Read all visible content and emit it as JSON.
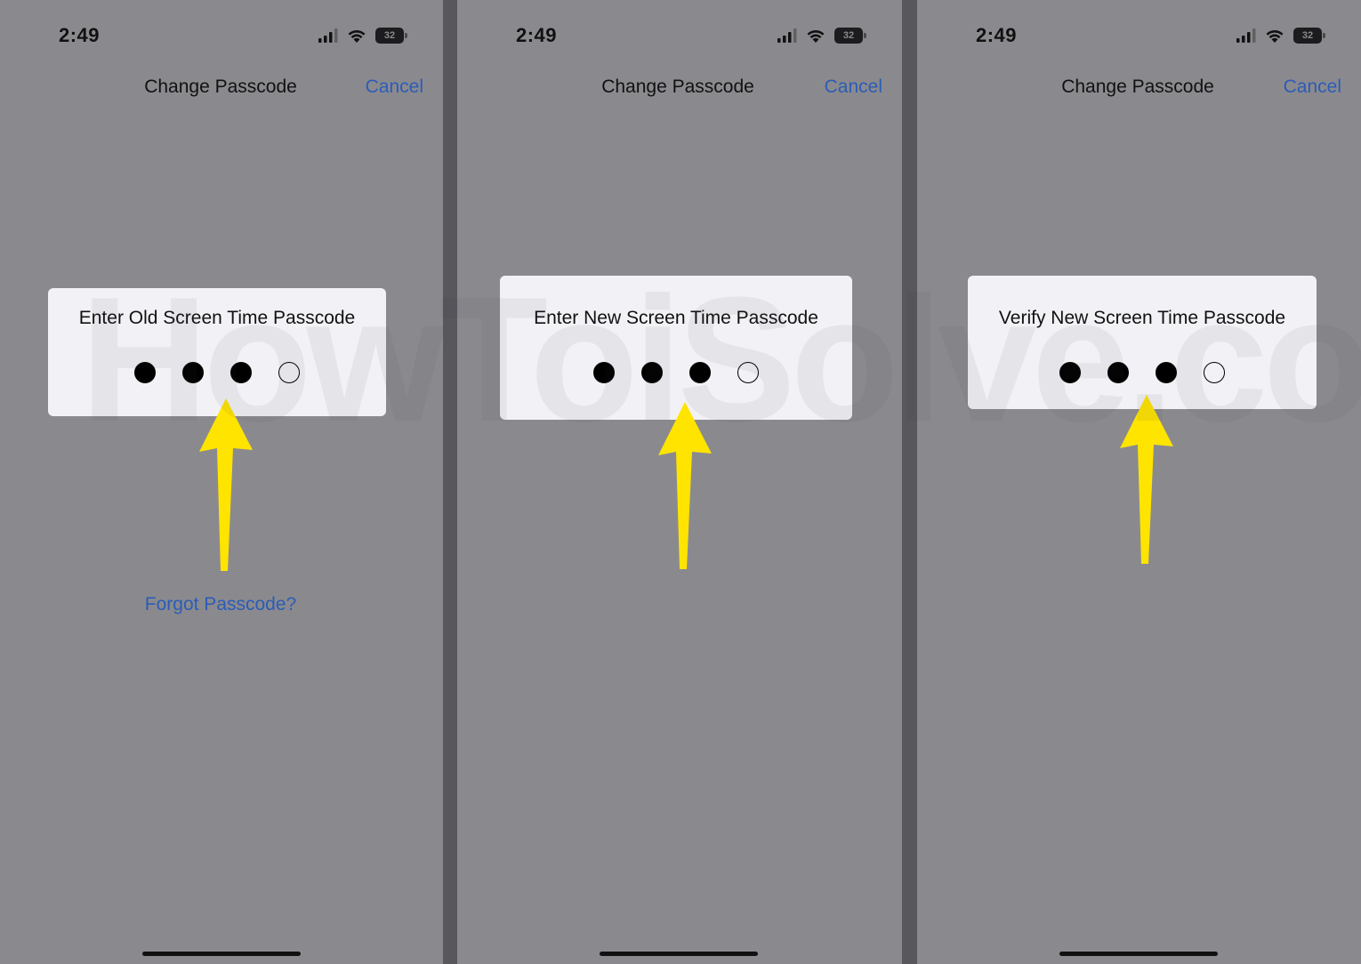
{
  "watermark": "HowToiSolve.com",
  "colors": {
    "accent": "#2c5cb6",
    "arrow": "#ffe400",
    "screen_background": "#8a8a8e",
    "card_background": "#f2f2f6"
  },
  "screens": [
    {
      "status": {
        "time": "2:49",
        "battery": "32"
      },
      "nav": {
        "title": "Change Passcode",
        "cancel": "Cancel"
      },
      "prompt": "Enter Old Screen Time Passcode",
      "digits_entered": 3,
      "digits_total": 4,
      "forgot": "Forgot Passcode?"
    },
    {
      "status": {
        "time": "2:49",
        "battery": "32"
      },
      "nav": {
        "title": "Change Passcode",
        "cancel": "Cancel"
      },
      "prompt": "Enter New Screen Time Passcode",
      "digits_entered": 3,
      "digits_total": 4
    },
    {
      "status": {
        "time": "2:49",
        "battery": "32"
      },
      "nav": {
        "title": "Change Passcode",
        "cancel": "Cancel"
      },
      "prompt": "Verify New Screen Time Passcode",
      "digits_entered": 3,
      "digits_total": 4
    }
  ],
  "icons": [
    "signal-icon",
    "wifi-icon",
    "battery-icon",
    "arrow-up-icon"
  ]
}
